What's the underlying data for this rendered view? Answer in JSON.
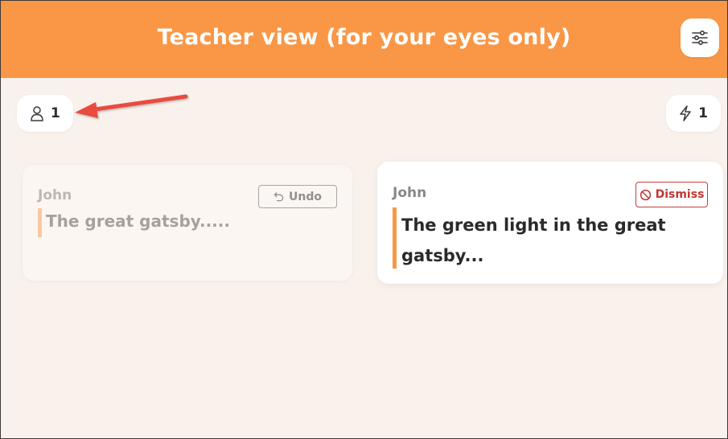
{
  "header": {
    "title": "Teacher view (for your eyes only)",
    "settings_icon": "sliders-icon"
  },
  "participants": {
    "icon": "person-icon",
    "count": "1"
  },
  "responses": {
    "icon": "lightning-icon",
    "count": "1"
  },
  "cards": [
    {
      "author": "John",
      "text": "The great gatsby.....",
      "action_label": "Undo",
      "action_icon": "undo-icon",
      "state": "dismissed"
    },
    {
      "author": "John",
      "text": "The green light in the great gatsby...",
      "action_label": "Dismiss",
      "action_icon": "prohibited-icon",
      "state": "active"
    }
  ],
  "colors": {
    "header": "#f99746",
    "background": "#f8f1ec",
    "accent_bar": "#f99746",
    "dismiss": "#c23535",
    "annotation_arrow": "#e94b3f"
  }
}
